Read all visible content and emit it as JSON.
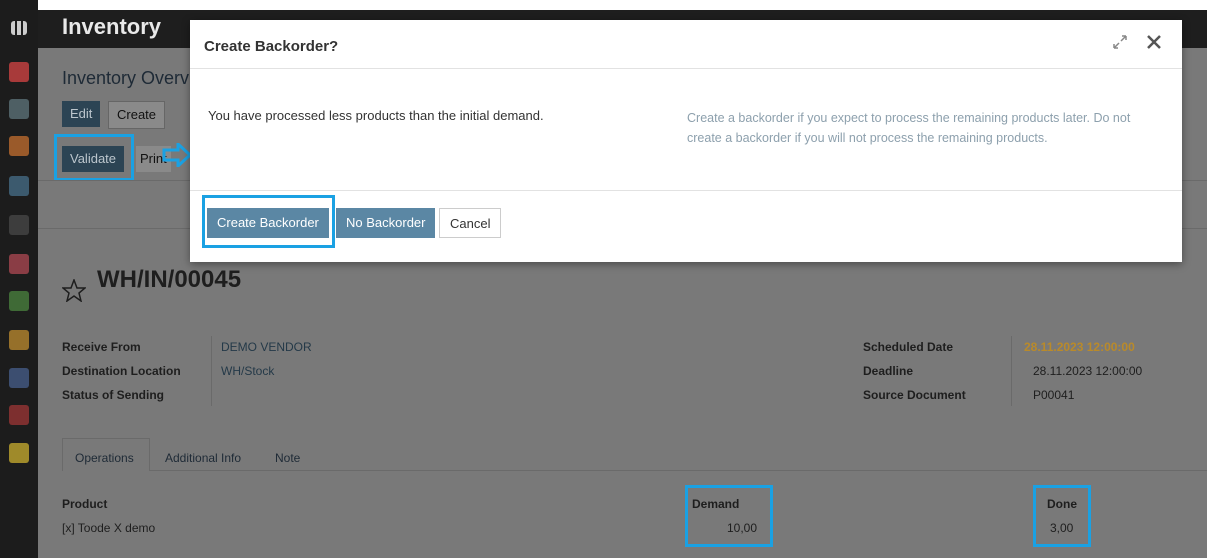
{
  "app": {
    "title": "Inventory"
  },
  "breadcrumb": "Inventory Overvi",
  "toolbar": {
    "edit": "Edit",
    "create": "Create",
    "validate": "Validate",
    "print": "Print"
  },
  "record": {
    "name": "WH/IN/00045"
  },
  "fields_left": [
    {
      "label": "Receive From",
      "value": "DEMO VENDOR"
    },
    {
      "label": "Destination Location",
      "value": "WH/Stock"
    },
    {
      "label": "Status of Sending",
      "value": ""
    }
  ],
  "fields_right": [
    {
      "label": "Scheduled Date",
      "value": "28.11.2023 12:00:00"
    },
    {
      "label": "Deadline",
      "value": "28.11.2023 12:00:00"
    },
    {
      "label": "Source Document",
      "value": "P00041"
    }
  ],
  "tabs": [
    "Operations",
    "Additional Info",
    "Note"
  ],
  "table": {
    "headers": {
      "product": "Product",
      "demand": "Demand",
      "done": "Done"
    },
    "rows": [
      {
        "product": "[x] Toode X demo",
        "demand": "10,00",
        "done": "3,00"
      }
    ]
  },
  "modal": {
    "title": "Create Backorder?",
    "message": "You have processed less products than the initial demand.",
    "hint_line1": "Create a backorder if you expect to process the remaining products later. Do not",
    "hint_line2": "create a backorder if you will not process the remaining products.",
    "buttons": {
      "create_backorder": "Create Backorder",
      "no_backorder": "No Backorder",
      "cancel": "Cancel"
    }
  },
  "colors": {
    "highlight": "#1aa1e3",
    "primary_button": "#5b87a4",
    "scheduled_date": "#b98a2a"
  },
  "icons": [
    "apps-grid-icon",
    "discuss-icon",
    "calendar-icon",
    "chart-icon",
    "sheet-icon",
    "link-icon",
    "flow-icon",
    "wrench-icon",
    "document-icon",
    "notes-icon",
    "group-icon",
    "settings-icon",
    "star-icon",
    "expand-icon",
    "close-icon",
    "arrow-right-icon"
  ]
}
